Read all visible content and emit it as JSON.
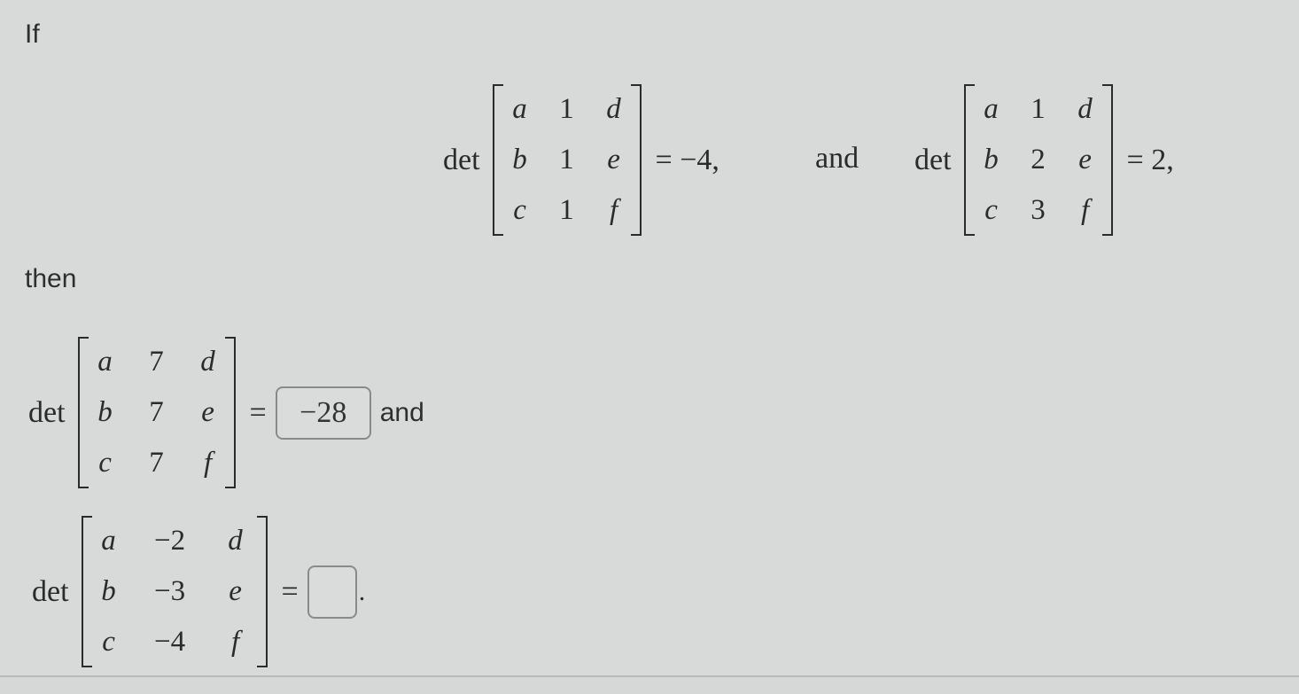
{
  "question": {
    "intro": "If",
    "given": [
      {
        "label": "det",
        "matrix": [
          [
            "a",
            "1",
            "d"
          ],
          [
            "b",
            "1",
            "e"
          ],
          [
            "c",
            "1",
            "f"
          ]
        ],
        "equals": "= −4,"
      },
      {
        "label": "det",
        "matrix": [
          [
            "a",
            "1",
            "d"
          ],
          [
            "b",
            "2",
            "e"
          ],
          [
            "c",
            "3",
            "f"
          ]
        ],
        "equals": "= 2,"
      }
    ],
    "connector": "and",
    "then": "then",
    "parts": [
      {
        "label": "det",
        "matrix": [
          [
            "a",
            "7",
            "d"
          ],
          [
            "b",
            "7",
            "e"
          ],
          [
            "c",
            "7",
            "f"
          ]
        ],
        "equals": "=",
        "answer_value": "−28",
        "after_text": "and"
      },
      {
        "label": "det",
        "matrix": [
          [
            "a",
            "−2",
            "d"
          ],
          [
            "b",
            "−3",
            "e"
          ],
          [
            "c",
            "−4",
            "f"
          ]
        ],
        "equals": "=",
        "answer_value": "",
        "after_text": "."
      }
    ]
  }
}
